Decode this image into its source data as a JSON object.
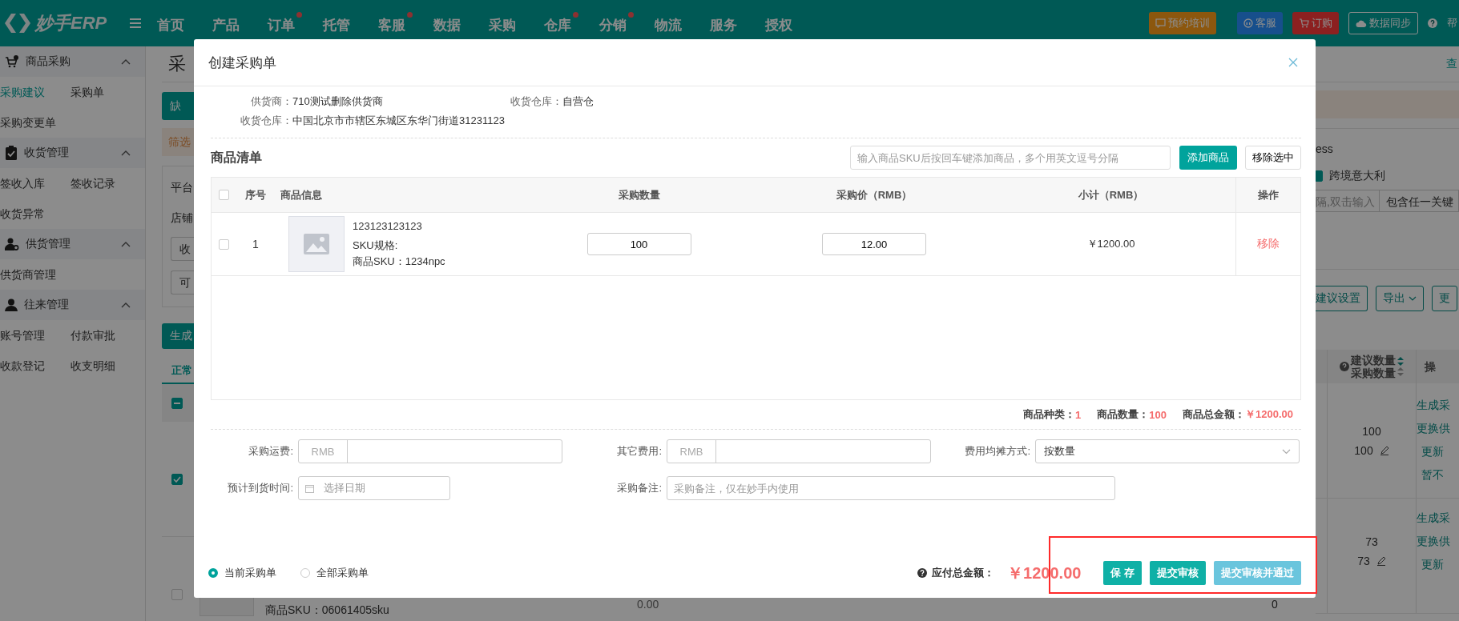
{
  "header": {
    "logo": "妙手ERP",
    "nav": [
      {
        "label": "首页",
        "dot": false
      },
      {
        "label": "产品",
        "dot": false
      },
      {
        "label": "订单",
        "dot": true
      },
      {
        "label": "托管",
        "dot": false
      },
      {
        "label": "客服",
        "dot": true
      },
      {
        "label": "数据",
        "dot": false
      },
      {
        "label": "采购",
        "dot": false
      },
      {
        "label": "仓库",
        "dot": true
      },
      {
        "label": "分销",
        "dot": true
      },
      {
        "label": "物流",
        "dot": false
      },
      {
        "label": "服务",
        "dot": false
      },
      {
        "label": "授权",
        "dot": false
      }
    ],
    "training": "预约培训",
    "service": "客服",
    "order": "订购",
    "sync": "数据同步",
    "help": "帮"
  },
  "sidebar": {
    "groups": [
      {
        "title": "商品采购",
        "expanded": true,
        "items": [
          {
            "label": "采购建议",
            "selected": true
          },
          {
            "label": "采购单",
            "selected": false
          },
          {
            "label": "采购变更单",
            "selected": false
          }
        ]
      },
      {
        "title": "收货管理",
        "expanded": true,
        "items": [
          {
            "label": "签收入库",
            "selected": false
          },
          {
            "label": "签收记录",
            "selected": false
          },
          {
            "label": "收货异常",
            "selected": false
          }
        ]
      },
      {
        "title": "供货管理",
        "expanded": true,
        "items": [
          {
            "label": "供货商管理",
            "selected": false
          }
        ]
      },
      {
        "title": "往来管理",
        "expanded": true,
        "items": [
          {
            "label": "账号管理",
            "selected": false
          },
          {
            "label": "付款审批",
            "selected": false
          },
          {
            "label": "收款登记",
            "selected": false
          },
          {
            "label": "收支明细",
            "selected": false
          }
        ]
      }
    ]
  },
  "page_left": {
    "title": "采",
    "top_button": "缺",
    "alert": "筛选",
    "filters": [
      "平台",
      "店铺"
    ],
    "fields": [
      "收",
      "可"
    ],
    "generate_button": "生成",
    "tab": "正常",
    "header_checkbox": {
      "indeterminate": true
    },
    "rows": [
      {
        "checked": true
      },
      {
        "checked": false
      }
    ]
  },
  "page_right": {
    "link": "查",
    "platform_text": "ess",
    "site": {
      "label": "跨境意大利",
      "checked": true
    },
    "keyword_placeholder": "隔,双击输入",
    "match_select": "包含任一关键",
    "buttons": [
      {
        "label": "建议设置",
        "caret": false
      },
      {
        "label": "导出",
        "caret": true
      },
      {
        "label": "更",
        "caret": false
      }
    ],
    "columns": [
      "建议数量",
      "采购数量",
      "操"
    ],
    "rows": [
      {
        "suggested": "100",
        "purchase": "100",
        "actions": [
          "生成采",
          "更换供",
          "更新",
          "暂不"
        ]
      },
      {
        "suggested": "73",
        "purchase": "73",
        "actions": [
          "生成采",
          "更换供",
          "更新"
        ]
      }
    ]
  },
  "page_bottom": {
    "sku": "商品SKU：06061405sku",
    "price": "0.00",
    "count": "0"
  },
  "modal": {
    "title": "创建采购单",
    "supplier": {
      "label": "供货商：",
      "value": "710测试删除供货商"
    },
    "warehouse": {
      "label": "收货仓库：",
      "value": "自营仓"
    },
    "address": {
      "label": "收货仓库：",
      "value": "中国北京市市辖区东城区东华门街道31231123"
    },
    "list_title": "商品清单",
    "sku_input": {
      "placeholder": "输入商品SKU后按回车键添加商品，多个用英文逗号分隔"
    },
    "add_button": "添加商品",
    "remove_selected_button": "移除选中",
    "header_checked": false,
    "columns": [
      "序号",
      "商品信息",
      "采购数量",
      "采购价（RMB）",
      "小计（RMB）",
      "操作"
    ],
    "items": [
      {
        "checked": false,
        "index": "1",
        "name": "123123123123",
        "spec": "SKU规格:",
        "sku": "商品SKU：1234npc",
        "quantity": "100",
        "price": "12.00",
        "subtotal": "￥1200.00",
        "action": "移除"
      }
    ],
    "summary": [
      {
        "label": "商品种类：",
        "value": "1"
      },
      {
        "label": "商品数量：",
        "value": "100"
      },
      {
        "label": "商品总金额：",
        "value": "￥1200.00"
      }
    ],
    "shipping": {
      "label": "采购运费:",
      "addon": "RMB"
    },
    "other_fee": {
      "label": "其它费用:",
      "addon": "RMB"
    },
    "allocation": {
      "label": "费用均摊方式:",
      "value": "按数量"
    },
    "eta": {
      "label": "预计到货时间:",
      "placeholder": "选择日期"
    },
    "remark": {
      "label": "采购备注:",
      "placeholder": "采购备注，仅在妙手内使用"
    },
    "scope": [
      {
        "label": "当前采购单",
        "selected": true
      },
      {
        "label": "全部采购单",
        "selected": false
      }
    ],
    "total": {
      "label": "应付总金额：",
      "value": "￥1200.00"
    },
    "actions": [
      {
        "label": "保 存",
        "kind": "primary"
      },
      {
        "label": "提交审核",
        "kind": "primary"
      },
      {
        "label": "提交审核并通过",
        "kind": "light"
      }
    ]
  }
}
